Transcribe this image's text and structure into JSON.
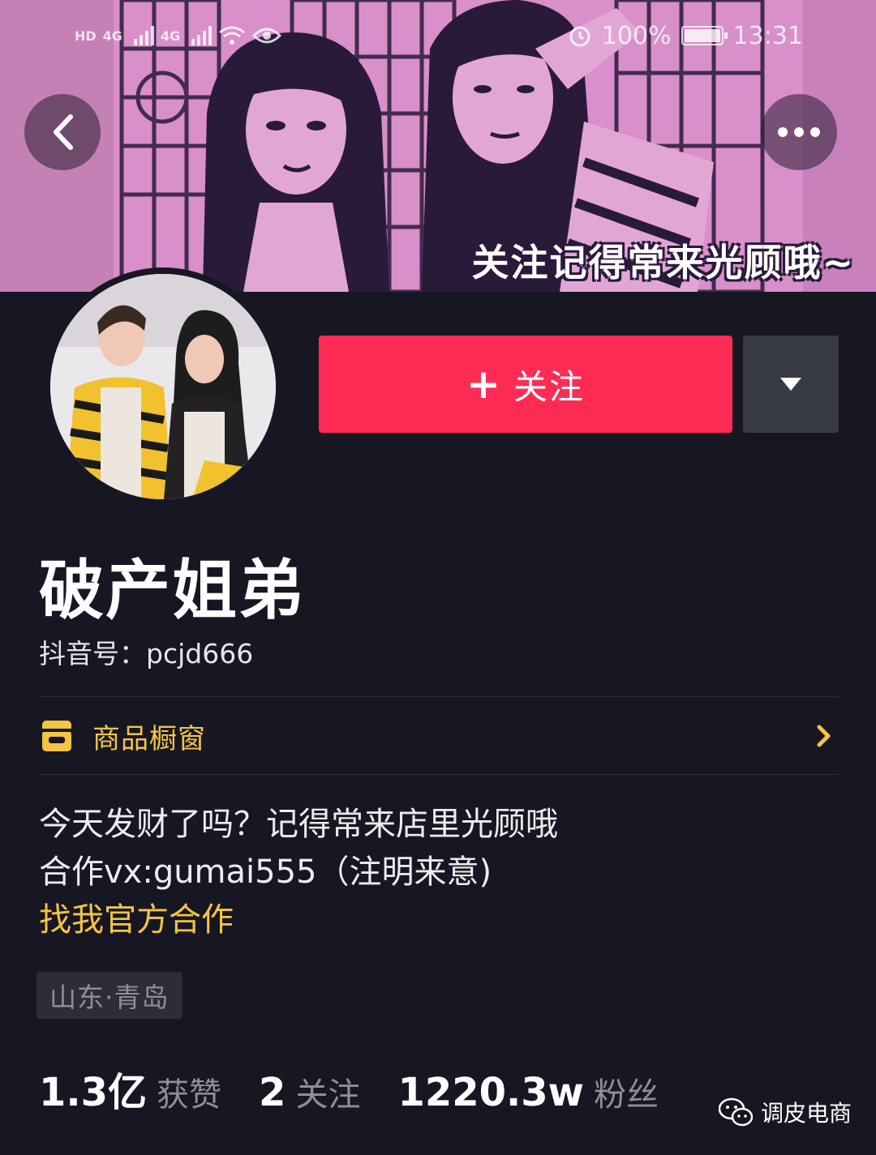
{
  "status_bar": {
    "hd1": "HD",
    "hd2": "HD",
    "net1": "4G",
    "net2": "4G",
    "battery": "100%",
    "time": "13:31"
  },
  "cover": {
    "caption": "关注记得常来光顾哦~"
  },
  "actions": {
    "follow_plus": "+",
    "follow_label": "关注"
  },
  "profile": {
    "name": "破产姐弟",
    "account_id": "抖音号：pcjd666"
  },
  "shop": {
    "label": "商品橱窗",
    "accent_color": "#f5c442"
  },
  "bio": {
    "line1": "今天发财了吗？记得常来店里光顾哦",
    "line2": "合作vx:gumai555（注明来意)",
    "link": "找我官方合作"
  },
  "location": "山东·青岛",
  "stats": [
    {
      "value": "1.3亿",
      "label": "获赞"
    },
    {
      "value": "2",
      "label": "关注"
    },
    {
      "value": "1220.3w",
      "label": "粉丝"
    }
  ],
  "watermark": {
    "text": "调皮电商"
  },
  "colors": {
    "background": "#161722",
    "follow_button": "#fe2c55",
    "cover_tint": "#d98fc9"
  },
  "icons": [
    "back-arrow-icon",
    "more-dots-icon",
    "dropdown-triangle-icon",
    "shop-icon",
    "chevron-right-icon",
    "wechat-icon",
    "alarm-icon",
    "wifi-icon",
    "eye-icon",
    "battery-icon"
  ]
}
